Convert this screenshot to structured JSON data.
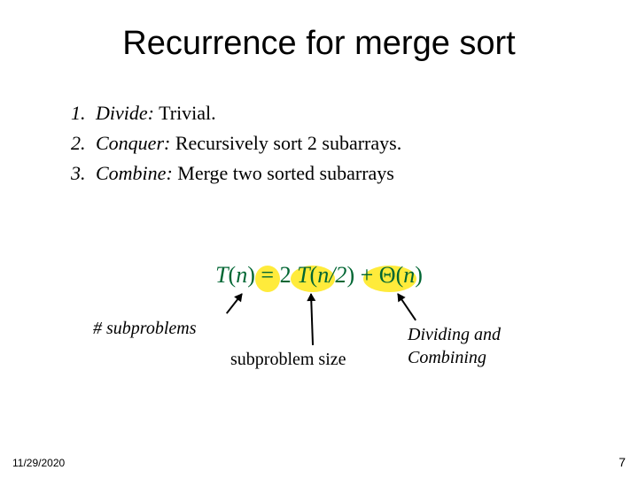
{
  "title": "Recurrence for merge sort",
  "steps": [
    {
      "num": "1.",
      "name": "Divide:",
      "desc": " Trivial."
    },
    {
      "num": "2.",
      "name": "Conquer:",
      "desc": " Recursively sort 2 subarrays."
    },
    {
      "num": "3.",
      "name": "Combine:",
      "desc": " Merge two sorted subarrays"
    }
  ],
  "formula": {
    "lhs_var": "T",
    "lhs_arg": "n",
    "eq": " = ",
    "coeff": "2",
    "mid_var": "T",
    "mid_arg": "n/2",
    "plus": " + ",
    "theta": "Θ",
    "theta_arg": "n"
  },
  "annotations": {
    "subproblems": "# subproblems",
    "size": "subproblem size",
    "dividing_l1": "Dividing and",
    "dividing_l2": "Combining"
  },
  "footer": {
    "date": "11/29/2020",
    "page": "7"
  }
}
